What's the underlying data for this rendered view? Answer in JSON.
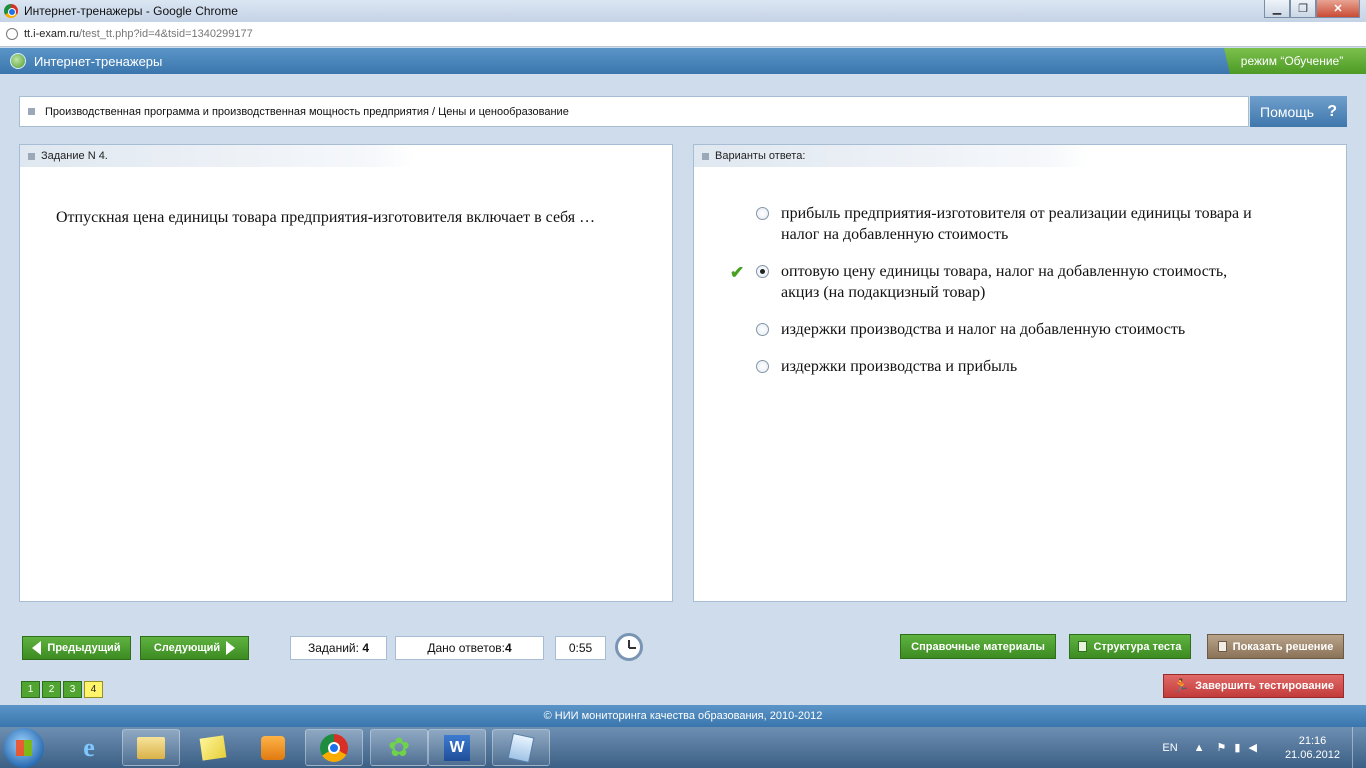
{
  "window": {
    "title": "Интернет-тренажеры - Google Chrome",
    "url_host": "tt.i-exam.ru",
    "url_path": "/test_tt.php?id=4&tsid=1340299177"
  },
  "app": {
    "title": "Интернет-тренажеры",
    "mode": "режим “Обучение”"
  },
  "breadcrumb": {
    "text": "Производственная программа и производственная мощность предприятия / Цены и ценообразование",
    "help_label": "Помощь",
    "help_symbol": "?"
  },
  "task": {
    "header": "Задание N 4.",
    "question": "Отпускная цена единицы товара предприятия-изготовителя включает в себя …"
  },
  "answers": {
    "header": "Варианты ответа:",
    "options": [
      {
        "label": "прибыль предприятия-изготовителя от реализации единицы товара и налог на добавленную стоимость",
        "selected": false,
        "correct_mark": false
      },
      {
        "label": "оптовую цену единицы товара, налог на добавленную стоимость, акциз (на подакцизный товар)",
        "selected": true,
        "correct_mark": true
      },
      {
        "label": "издержки производства и налог на добавленную стоимость",
        "selected": false,
        "correct_mark": false
      },
      {
        "label": "издержки производства и прибыль",
        "selected": false,
        "correct_mark": false
      }
    ]
  },
  "toolbar": {
    "prev_label": "Предыдущий",
    "next_label": "Следующий",
    "tasks_label": "Заданий:",
    "tasks_count": "4",
    "answered_label": "Дано ответов:",
    "answered_count": "4",
    "timer": "0:55",
    "reference_label": "Справочные материалы",
    "structure_label": "Структура теста",
    "solution_label": "Показать решение",
    "finish_label": "Завершить тестирование",
    "pages": [
      "1",
      "2",
      "3",
      "4"
    ],
    "current_page": "4"
  },
  "footer": {
    "copyright": "© НИИ мониторинга качества образования, 2010-2012"
  },
  "taskbar": {
    "language": "EN",
    "time": "21:16",
    "date": "21.06.2012",
    "apps": [
      "ie-icon",
      "explorer-icon",
      "sticky-notes-icon",
      "media-player-icon",
      "chrome-icon",
      "icq-icon",
      "word-icon",
      "notepad-icon"
    ]
  },
  "colors": {
    "header_blue": "#3a76ad",
    "mode_green": "#4d9a25",
    "button_green": "#3c8b22",
    "finish_red": "#c23b3a",
    "current_page_yellow": "#fff46a"
  }
}
